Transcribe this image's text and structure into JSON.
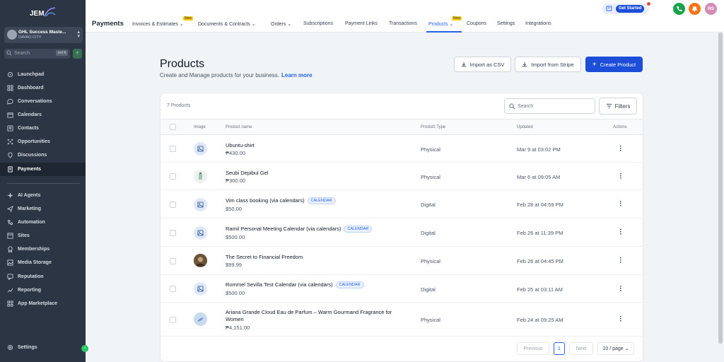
{
  "sidebar": {
    "logo_text": "JEM",
    "location_name": "GHL Success Maste...",
    "location_city": "DAVAO CITY",
    "search_placeholder": "Search",
    "search_shortcut": "ctrl K",
    "items": [
      {
        "label": "Launchpad",
        "icon": "rocket-icon"
      },
      {
        "label": "Dashboard",
        "icon": "grid-icon"
      },
      {
        "label": "Conversations",
        "icon": "chat-icon"
      },
      {
        "label": "Calendars",
        "icon": "calendar-icon"
      },
      {
        "label": "Contacts",
        "icon": "contacts-icon"
      },
      {
        "label": "Opportunities",
        "icon": "opportunities-icon"
      },
      {
        "label": "Discussions",
        "icon": "discussions-icon"
      },
      {
        "label": "Payments",
        "icon": "payments-icon",
        "active": true
      },
      {
        "label": "AI Agents",
        "icon": "sparkle-icon"
      },
      {
        "label": "Marketing",
        "icon": "send-icon"
      },
      {
        "label": "Automation",
        "icon": "automation-icon"
      },
      {
        "label": "Sites",
        "icon": "sites-icon"
      },
      {
        "label": "Memberships",
        "icon": "membership-icon"
      },
      {
        "label": "Media Storage",
        "icon": "image-icon"
      },
      {
        "label": "Reputation",
        "icon": "reputation-icon"
      },
      {
        "label": "Reporting",
        "icon": "chart-icon"
      },
      {
        "label": "App Marketplace",
        "icon": "apps-icon"
      }
    ],
    "settings_label": "Settings"
  },
  "topbar": {
    "title": "Payments",
    "tabs": [
      {
        "label": "Invoices & Estimates",
        "dropdown": true,
        "badge": "New"
      },
      {
        "label": "Documents & Contracts",
        "dropdown": true
      },
      {
        "label": "Orders",
        "dropdown": true
      },
      {
        "label": "Subscriptions"
      },
      {
        "label": "Payment Links"
      },
      {
        "label": "Transactions"
      },
      {
        "label": "Products",
        "dropdown": true,
        "badge": "New",
        "active": true
      },
      {
        "label": "Coupons"
      },
      {
        "label": "Settings"
      },
      {
        "label": "Integrations"
      }
    ],
    "get_started": "Get Started",
    "avatar_initials": "RS",
    "colors": {
      "phone": "#16a34a",
      "bell": "#f97316",
      "avatar": "#d48bb5",
      "accent": "#2563eb"
    }
  },
  "main": {
    "heading": "Products",
    "subheading": "Create and Manage products for your business.",
    "learn_more": "Learn more",
    "import_csv": "Import as CSV",
    "import_stripe": "Import from Stripe",
    "create_product": "Create Product",
    "product_count": "7 Products",
    "search_placeholder": "Search",
    "filters_label": "Filters",
    "columns": [
      "Image",
      "Product name",
      "Product Type",
      "Updated",
      "Actions"
    ],
    "products": [
      {
        "name": "Ubuntu-shirt",
        "price": "₱430.00",
        "type": "Physical",
        "updated": "Mar 9 at 03:02 PM",
        "tag": "",
        "image": "placeholder"
      },
      {
        "name": "Seubi Depibul Gel",
        "price": "₱300.00",
        "type": "Physical",
        "updated": "Mar 6 at 09:05 AM",
        "tag": "",
        "image": "bottle"
      },
      {
        "name": "Vim class booking (via calendars)",
        "price": "$50.00",
        "type": "Digital",
        "updated": "Feb 28 at 04:59 PM",
        "tag": "CALENDAR",
        "image": "placeholder"
      },
      {
        "name": "Ramil Personal Meeting Calendar (via calendars)",
        "price": "$500.00",
        "type": "Digital",
        "updated": "Feb 26 at 11:39 PM",
        "tag": "CALENDAR",
        "image": "placeholder"
      },
      {
        "name": "The Secret to Financial Freedom",
        "price": "$99.99",
        "type": "Physical",
        "updated": "Feb 26 at 04:45 PM",
        "tag": "",
        "image": "photo"
      },
      {
        "name": "Rommel Sevilla Test Calendar (via calendars)",
        "price": "$500.00",
        "type": "Digital",
        "updated": "Feb 25 at 03:11 AM",
        "tag": "CALENDAR",
        "image": "placeholder"
      },
      {
        "name": "Ariana Grande Cloud Eau de Parfum – Warm Gourmand Fragrance for Women",
        "price": "₱4,151.00",
        "type": "Physical",
        "updated": "Feb 24 at 09:25 AM",
        "tag": "",
        "image": "perfume"
      }
    ],
    "pagination": {
      "previous": "Previous",
      "page": "1",
      "next": "Next",
      "per_page": "10 / page"
    }
  }
}
